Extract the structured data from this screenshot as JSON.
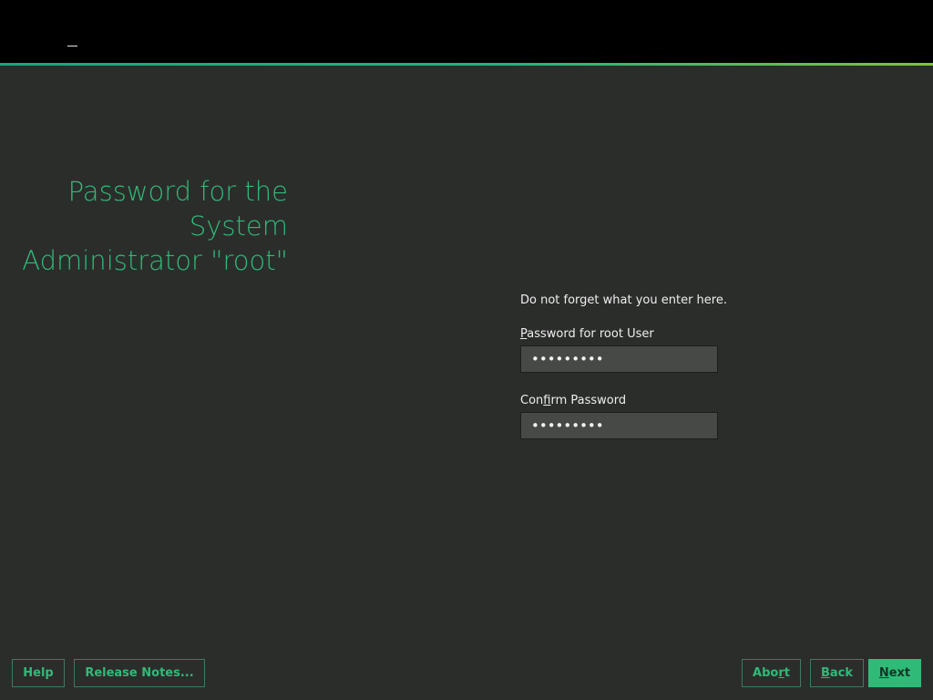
{
  "header": {
    "brand_mark": "-"
  },
  "page": {
    "title": "Password for the System Administrator \"root\""
  },
  "form": {
    "hint": "Do not forget what you enter here.",
    "password_label": {
      "mnemonic": "P",
      "rest": "assword for root User"
    },
    "password_value": "•••••••••",
    "confirm_label": {
      "before": "Con",
      "mnemonic": "f",
      "after": "irm Password"
    },
    "confirm_value": "•••••••••"
  },
  "footer": {
    "help_label": "Help",
    "release_notes_label": "Release Notes...",
    "abort_label": {
      "before": "Abo",
      "mnemonic": "r",
      "after": "t"
    },
    "back_label": {
      "mnemonic": "B",
      "rest": "ack"
    },
    "next_label": {
      "mnemonic": "N",
      "rest": "ext"
    }
  },
  "colors": {
    "accent": "#30ba78",
    "background": "#2b2d2b",
    "topbar": "#000000",
    "field_background": "#474947"
  }
}
